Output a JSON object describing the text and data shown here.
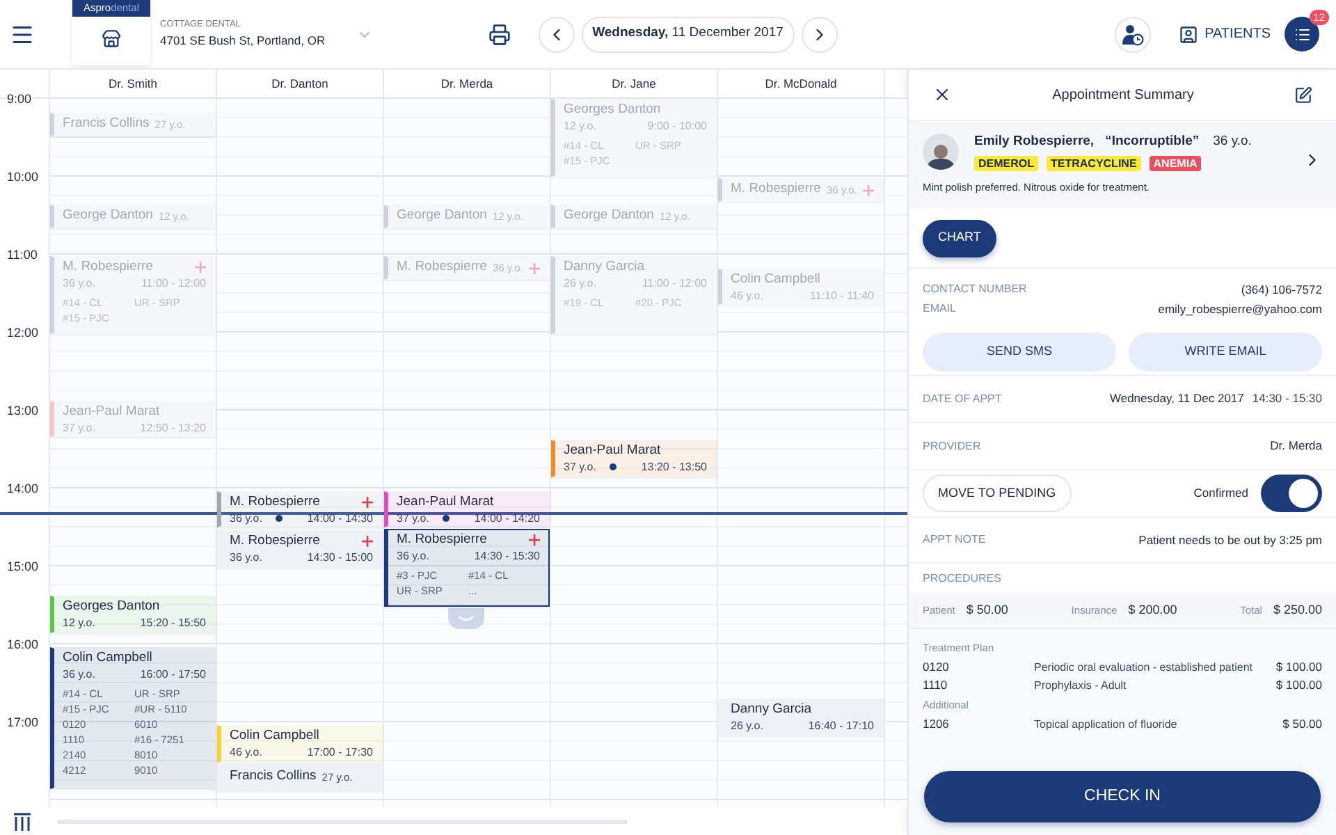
{
  "top_bar": {
    "brand_a": "Aspro",
    "brand_b": "dental",
    "clinic_name": "COTTAGE DENTAL",
    "clinic_address": "4701 SE Bush St, Portland, OR",
    "date_day": "Wednesday,",
    "date_rest": "11 December 2017",
    "patients_button": "PATIENTS",
    "notification_count": "12"
  },
  "time_labels": [
    "9:00",
    "10:00",
    "11:00",
    "12:00",
    "13:00",
    "14:00",
    "15:00",
    "16:00",
    "17:00"
  ],
  "columns": [
    {
      "doctor": "Dr. Smith",
      "appointments": [
        {
          "kind": "compact",
          "name": "Francis Collins",
          "age": "27 y.o.",
          "dimmed": true,
          "flag": false,
          "selected": false,
          "color": "#c9d3e0"
        },
        {
          "kind": "compact",
          "name": "George Danton",
          "age": "12 y.o.",
          "dimmed": true,
          "flag": false,
          "selected": false,
          "color": "#c9d3e0"
        },
        {
          "kind": "full",
          "name": "M. Robespierre",
          "age": "36 y.o.",
          "time": "11:00 - 12:00",
          "dot": false,
          "procedures": [
            "#14 - CL",
            "UR - SRP",
            "#15 - PJC"
          ],
          "dimmed": true,
          "flag": true,
          "selected": false,
          "color": "#c9d3e0"
        },
        {
          "kind": "full",
          "name": "Jean-Paul Marat",
          "age": "37 y.o.",
          "time": "12:50 - 13:20",
          "dot": false,
          "dimmed": true,
          "flag": false,
          "selected": false,
          "color": "#f5c6cc"
        },
        {
          "kind": "full",
          "name": "Georges Danton",
          "age": "12 y.o.",
          "time": "15:20 - 15:50",
          "dot": false,
          "dimmed": false,
          "flag": false,
          "selected": false,
          "color": "#5cc84a"
        },
        {
          "kind": "full",
          "name": "Colin Campbell",
          "age": "36 y.o.",
          "time": "16:00 - 17:50",
          "dot": false,
          "procedures": [
            "#14 - CL",
            "UR - SRP",
            "#15 - PJC",
            "#UR - 5110",
            "0120",
            "6010",
            "1110",
            "#16 - 7251",
            "2140",
            "8010",
            "4212",
            "9010"
          ],
          "dimmed": false,
          "flag": false,
          "selected": false,
          "color": "#1c3a78"
        }
      ]
    },
    {
      "doctor": "Dr. Danton",
      "appointments": [
        {
          "kind": "full",
          "name": "M. Robespierre",
          "age": "36 y.o.",
          "time": "14:00 - 14:30",
          "dot": true,
          "dimmed": false,
          "flag": true,
          "selected": false,
          "color": "#a3a7ad"
        },
        {
          "kind": "full",
          "name": "M. Robespierre",
          "age": "36 y.o.",
          "time": "14:30 - 15:00",
          "dot": false,
          "dimmed": false,
          "flag": true,
          "selected": false
        },
        {
          "kind": "full",
          "name": "Colin Campbell",
          "age": "46 y.o.",
          "time": "17:00 - 17:30",
          "dot": false,
          "dimmed": false,
          "flag": false,
          "selected": false,
          "color": "#f2d43a"
        },
        {
          "kind": "compact",
          "name": "Francis Collins",
          "age": "27 y.o.",
          "dimmed": false,
          "flag": false,
          "selected": false
        }
      ]
    },
    {
      "doctor": "Dr. Merda",
      "appointments": [
        {
          "kind": "compact",
          "name": "George Danton",
          "age": "12 y.o.",
          "dimmed": true,
          "flag": false,
          "selected": false,
          "color": "#c9d3e0"
        },
        {
          "kind": "compact",
          "name": "M. Robespierre",
          "age": "36 y.o.",
          "dimmed": true,
          "flag": true,
          "selected": false,
          "color": "#c9d3e0"
        },
        {
          "kind": "full",
          "name": "Jean-Paul Marat",
          "age": "37 y.o.",
          "time": "14:00 - 14:20",
          "dot": true,
          "dimmed": false,
          "flag": false,
          "selected": false,
          "color": "#e04fc0"
        },
        {
          "kind": "full",
          "name": "M. Robespierre",
          "age": "36 y.o.",
          "time": "14:30 - 15:30",
          "dot": false,
          "procedures": [
            "#3 - PJC",
            "#14 - CL",
            "UR - SRP",
            "..."
          ],
          "dimmed": false,
          "flag": true,
          "selected": true,
          "color": "#1c3a78"
        }
      ]
    },
    {
      "doctor": "Dr. Jane",
      "appointments": [
        {
          "kind": "full",
          "name": "Georges Danton",
          "age": "12 y.o.",
          "time": "9:00 - 10:00",
          "dot": false,
          "procedures": [
            "#14 - CL",
            "UR - SRP",
            "#15 - PJC"
          ],
          "dimmed": true,
          "flag": false,
          "selected": false,
          "color": "#c9d3e0"
        },
        {
          "kind": "compact",
          "name": "George Danton",
          "age": "12 y.o.",
          "dimmed": true,
          "flag": false,
          "selected": false,
          "color": "#c9d3e0"
        },
        {
          "kind": "full",
          "name": "Danny Garcia",
          "age": "26 y.o.",
          "time": "11:00 - 12:00",
          "dot": false,
          "procedures": [
            "#19 - CL",
            "#20 - PJC"
          ],
          "dimmed": true,
          "flag": false,
          "selected": false,
          "color": "#c9d3e0"
        },
        {
          "kind": "full",
          "name": "Jean-Paul Marat",
          "age": "37 y.o.",
          "time": "13:20 - 13:50",
          "dot": true,
          "dimmed": false,
          "flag": false,
          "selected": false,
          "color": "#f28c28"
        }
      ]
    },
    {
      "doctor": "Dr. McDonald",
      "appointments": [
        {
          "kind": "compact",
          "name": "M. Robespierre",
          "age": "36 y.o.",
          "dimmed": true,
          "flag": true,
          "selected": false,
          "color": "#c9d3e0"
        },
        {
          "kind": "full",
          "name": "Colin Campbell",
          "age": "46 y.o.",
          "time": "11:10 - 11:40",
          "dot": false,
          "dimmed": true,
          "flag": false,
          "selected": false,
          "color": "#c9d3e0"
        },
        {
          "kind": "full",
          "name": "Danny Garcia",
          "age": "26 y.o.",
          "time": "16:40 - 17:10",
          "dot": false,
          "dimmed": false,
          "flag": false,
          "selected": false
        }
      ]
    }
  ],
  "summary": {
    "title": "Appointment Summary",
    "patient": {
      "name": "Emily Robespierre,",
      "nickname": "“Incorruptible”",
      "age": "36 y.o.",
      "tags": [
        {
          "label": "DEMEROL",
          "color": "#f7ea3a"
        },
        {
          "label": "TETRACYCLINE",
          "color": "#f7ea3a"
        },
        {
          "label": "ANEMIA",
          "color": "#e9505f"
        }
      ],
      "note": "Mint polish preferred. Nitrous oxide for treatment."
    },
    "chart_button": "CHART",
    "contact": [
      {
        "label": "CONTACT NUMBER",
        "value": "(364) 106-7572"
      },
      {
        "label": "EMAIL",
        "value": "emily_robespierre@yahoo.com"
      }
    ],
    "actions": [
      "SEND SMS",
      "WRITE EMAIL"
    ],
    "date": {
      "label": "DATE OF APPT",
      "day": "Wednesday, 11 Dec 2017",
      "time": "14:30 - 15:30"
    },
    "provider": {
      "label": "PROVIDER",
      "value": "Dr. Merda"
    },
    "pending_button": "MOVE TO PENDING",
    "confirmed": {
      "label": "Confirmed",
      "on": true
    },
    "note": {
      "label": "APPT NOTE",
      "value": "Patient needs to be out by 3:25 pm"
    },
    "procedures": {
      "label": "PROCEDURES",
      "totals": [
        {
          "label": "Patient",
          "amount": "$ 50.00"
        },
        {
          "label": "Insurance",
          "amount": "$ 200.00"
        },
        {
          "label": "Total",
          "amount": "$ 250.00"
        }
      ],
      "groups": [
        {
          "title": "Treatment Plan",
          "items": [
            {
              "code": "0120",
              "description": "Periodic oral evaluation - established patient",
              "amount": "$ 100.00"
            },
            {
              "code": "1110",
              "description": "Prophylaxis - Adult",
              "amount": "$ 100.00"
            }
          ]
        },
        {
          "title": "Additional",
          "items": [
            {
              "code": "1206",
              "description": "Topical application of fluoride",
              "amount": "$ 50.00"
            }
          ]
        }
      ]
    },
    "check_in_button": "CHECK IN"
  }
}
